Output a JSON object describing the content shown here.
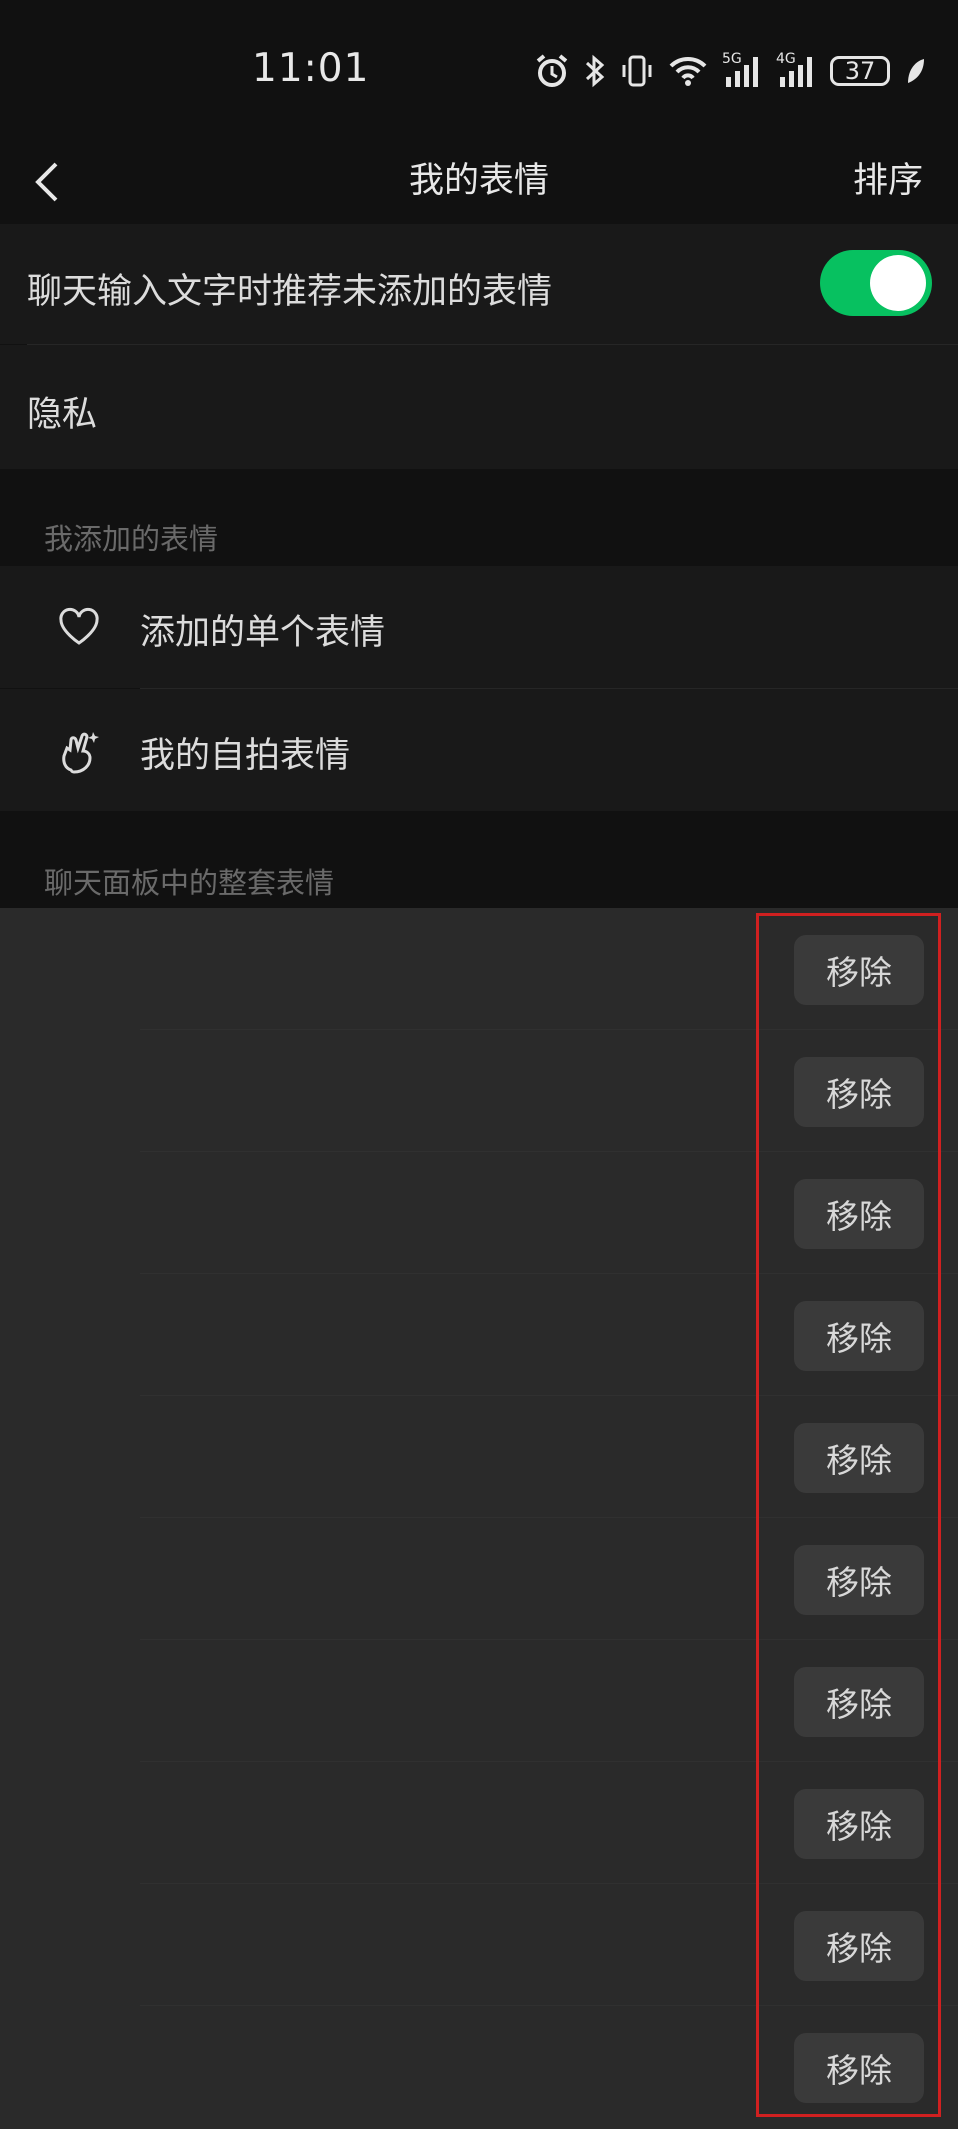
{
  "status_bar": {
    "time": "11:01",
    "battery": "37",
    "icons": [
      "alarm-icon",
      "bluetooth-icon",
      "vibrate-icon",
      "wifi-icon",
      "5g-signal-icon",
      "4g-signal-icon",
      "battery-icon",
      "leaf-icon"
    ],
    "net1": "5G",
    "net2": "4G"
  },
  "nav": {
    "title": "我的表情",
    "right_action": "排序"
  },
  "settings": {
    "recommend_label": "聊天输入文字时推荐未添加的表情",
    "recommend_enabled": true,
    "privacy_label": "隐私"
  },
  "added_section": {
    "header": "我添加的表情",
    "items": [
      {
        "label": "添加的单个表情",
        "icon": "heart-icon"
      },
      {
        "label": "我的自拍表情",
        "icon": "selfie-hand-icon"
      }
    ]
  },
  "packs_section": {
    "header": "聊天面板中的整套表情",
    "remove_label": "移除",
    "rows": [
      {
        "remove": "移除"
      },
      {
        "remove": "移除"
      },
      {
        "remove": "移除"
      },
      {
        "remove": "移除"
      },
      {
        "remove": "移除"
      },
      {
        "remove": "移除"
      },
      {
        "remove": "移除"
      },
      {
        "remove": "移除"
      },
      {
        "remove": "移除"
      },
      {
        "remove": "移除"
      }
    ]
  },
  "colors": {
    "toggle_on": "#07c160",
    "highlight": "#d02020"
  }
}
